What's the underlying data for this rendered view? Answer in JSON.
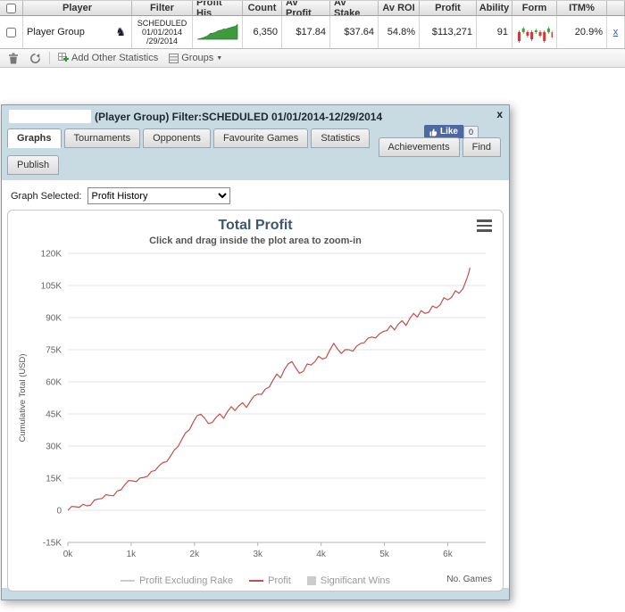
{
  "table": {
    "columns": [
      "Player",
      "Filter",
      "Profit His",
      "Count",
      "Av Profit",
      "Av Stake",
      "Av ROI",
      "Profit",
      "Ability",
      "Form",
      "ITM%"
    ],
    "row": {
      "player": "Player Group",
      "filter_lines": [
        "SCHEDULED",
        "01/01/2014",
        "/29/2014"
      ],
      "count": "6,350",
      "av_profit": "$17.84",
      "av_stake": "$37.64",
      "av_roi": "54.8%",
      "profit": "$113,271",
      "ability": "91",
      "itm": "20.9%",
      "remove_label": "x"
    }
  },
  "toolbar": {
    "add_stats_label": "Add Other Statistics",
    "groups_label": "Groups"
  },
  "dialog": {
    "title": "(Player Group) Filter:SCHEDULED 01/01/2014-12/29/2014",
    "close_label": "x",
    "fb": {
      "like_label": "Like",
      "count": "0"
    },
    "tabs": [
      "Graphs",
      "Tournaments",
      "Opponents",
      "Favourite Games",
      "Statistics",
      "Achievements",
      "Find",
      "Publish"
    ],
    "active_tab": "Graphs",
    "graph_selected_label": "Graph Selected:",
    "graph_selected_value": "Profit History"
  },
  "sparklines": {
    "profit_history_color": "#3d9b3d",
    "form": {
      "bars": [
        -5,
        2,
        -2,
        -4,
        1,
        -2,
        -5,
        2,
        -3
      ],
      "up_color": "#3aa63a",
      "down_color": "#cc3a3a"
    }
  },
  "chart_data": {
    "type": "line",
    "title": "Total Profit",
    "subtitle": "Click and drag inside the plot area to zoom-in",
    "ylabel": "Cumulative Total (USD)",
    "xlabel": "No. Games",
    "xlim": [
      0,
      6600
    ],
    "ylim": [
      -15000,
      120000
    ],
    "xticks": {
      "values": [
        0,
        1000,
        2000,
        3000,
        4000,
        5000,
        6000
      ],
      "labels": [
        "0k",
        "1k",
        "2k",
        "3k",
        "4k",
        "5k",
        "6k"
      ]
    },
    "yticks": {
      "values": [
        -15000,
        0,
        15000,
        30000,
        45000,
        60000,
        75000,
        90000,
        105000,
        120000
      ],
      "labels": [
        "-15K",
        "0",
        "15K",
        "30K",
        "45K",
        "60K",
        "75K",
        "90K",
        "105K",
        "120K"
      ]
    },
    "legend": [
      {
        "label": "Profit Excluding Rake",
        "type": "line",
        "color": "#cccccc"
      },
      {
        "label": "Profit",
        "type": "line",
        "color": "#c0504d"
      },
      {
        "label": "Significant Wins",
        "type": "box",
        "color": "#cccccc"
      }
    ],
    "series": [
      {
        "name": "Profit",
        "color": "#c0504d",
        "points": [
          [
            0,
            0
          ],
          [
            60,
            800
          ],
          [
            120,
            1800
          ],
          [
            180,
            1200
          ],
          [
            240,
            2400
          ],
          [
            300,
            3200
          ],
          [
            360,
            2800
          ],
          [
            420,
            4200
          ],
          [
            480,
            5500
          ],
          [
            540,
            5000
          ],
          [
            600,
            6500
          ],
          [
            660,
            7800
          ],
          [
            720,
            7200
          ],
          [
            780,
            8800
          ],
          [
            840,
            10200
          ],
          [
            900,
            11500
          ],
          [
            960,
            12800
          ],
          [
            1020,
            14200
          ],
          [
            1080,
            13600
          ],
          [
            1140,
            15000
          ],
          [
            1200,
            16400
          ],
          [
            1260,
            15800
          ],
          [
            1320,
            17200
          ],
          [
            1380,
            18800
          ],
          [
            1440,
            20500
          ],
          [
            1500,
            22000
          ],
          [
            1560,
            23800
          ],
          [
            1620,
            25500
          ],
          [
            1680,
            27500
          ],
          [
            1740,
            30000
          ],
          [
            1800,
            32500
          ],
          [
            1860,
            35500
          ],
          [
            1920,
            38500
          ],
          [
            1980,
            41500
          ],
          [
            2040,
            44000
          ],
          [
            2100,
            45500
          ],
          [
            2160,
            42500
          ],
          [
            2220,
            39500
          ],
          [
            2280,
            41500
          ],
          [
            2340,
            43500
          ],
          [
            2400,
            45000
          ],
          [
            2460,
            44000
          ],
          [
            2520,
            45800
          ],
          [
            2580,
            47500
          ],
          [
            2640,
            46800
          ],
          [
            2700,
            48500
          ],
          [
            2760,
            50000
          ],
          [
            2820,
            49200
          ],
          [
            2880,
            51000
          ],
          [
            2940,
            52800
          ],
          [
            3000,
            54500
          ],
          [
            3060,
            53500
          ],
          [
            3120,
            56000
          ],
          [
            3180,
            58500
          ],
          [
            3240,
            61000
          ],
          [
            3300,
            63500
          ],
          [
            3360,
            62500
          ],
          [
            3420,
            65000
          ],
          [
            3480,
            67500
          ],
          [
            3540,
            70000
          ],
          [
            3600,
            66500
          ],
          [
            3660,
            64000
          ],
          [
            3720,
            66000
          ],
          [
            3780,
            68000
          ],
          [
            3840,
            67000
          ],
          [
            3900,
            69500
          ],
          [
            3960,
            71500
          ],
          [
            4020,
            70500
          ],
          [
            4080,
            72500
          ],
          [
            4140,
            75000
          ],
          [
            4200,
            77500
          ],
          [
            4260,
            75500
          ],
          [
            4320,
            72500
          ],
          [
            4380,
            74500
          ],
          [
            4440,
            76000
          ],
          [
            4500,
            74500
          ],
          [
            4560,
            76500
          ],
          [
            4620,
            78500
          ],
          [
            4680,
            77500
          ],
          [
            4740,
            79500
          ],
          [
            4800,
            81500
          ],
          [
            4860,
            80500
          ],
          [
            4920,
            82500
          ],
          [
            4980,
            84500
          ],
          [
            5040,
            83500
          ],
          [
            5100,
            85500
          ],
          [
            5160,
            84500
          ],
          [
            5220,
            86500
          ],
          [
            5280,
            88500
          ],
          [
            5340,
            87500
          ],
          [
            5400,
            89500
          ],
          [
            5460,
            91500
          ],
          [
            5520,
            90500
          ],
          [
            5580,
            92500
          ],
          [
            5640,
            91500
          ],
          [
            5700,
            93500
          ],
          [
            5760,
            95500
          ],
          [
            5820,
            94500
          ],
          [
            5880,
            96500
          ],
          [
            5940,
            98500
          ],
          [
            6000,
            97500
          ],
          [
            6060,
            100000
          ],
          [
            6120,
            102500
          ],
          [
            6180,
            101500
          ],
          [
            6240,
            104500
          ],
          [
            6300,
            107500
          ],
          [
            6330,
            110000
          ],
          [
            6350,
            113271
          ]
        ]
      }
    ]
  }
}
